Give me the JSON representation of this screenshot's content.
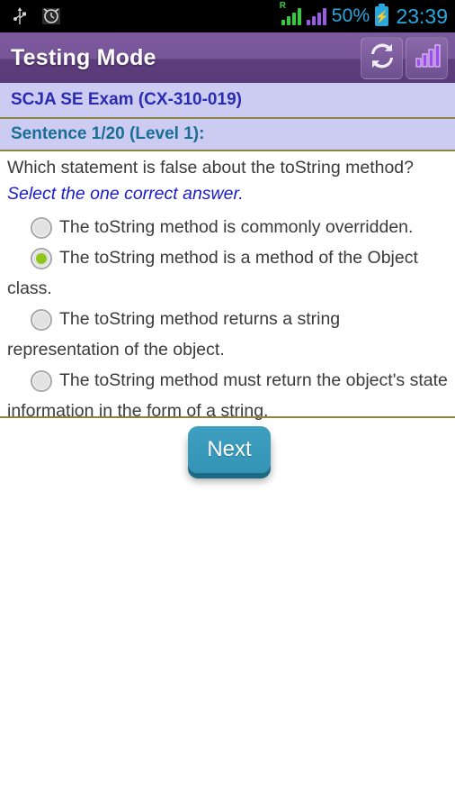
{
  "statusbar": {
    "icons": [
      "usb-icon",
      "alarm-clock-icon"
    ],
    "signal_roaming_label": "R",
    "battery_percent": "50%",
    "battery_state_icon": "battery-charging-icon",
    "time": "23:39",
    "text_color": "#29a8e0",
    "background": "#000000"
  },
  "actionbar": {
    "title": "Testing Mode",
    "background": "#78559a",
    "actions": [
      {
        "name": "refresh-button",
        "icon": "refresh-icon"
      },
      {
        "name": "statistics-button",
        "icon": "bar-chart-icon"
      }
    ]
  },
  "exam": {
    "title": "SCJA SE Exam (CX-310-019)",
    "band_background": "#ccccf2",
    "title_color": "#2b2bb0"
  },
  "sentence": {
    "label": "Sentence 1/20 (Level 1):",
    "label_color": "#1a6e95",
    "current": 1,
    "total": 20,
    "level": 1
  },
  "question": {
    "text": "Which statement is false about the toString method?",
    "hint": "Select the one correct answer.",
    "hint_color": "#1a1ad0"
  },
  "options": [
    {
      "text": "The toString method is commonly overridden.",
      "selected": false
    },
    {
      "text": "The toString method is a method of the Object class.",
      "selected": true
    },
    {
      "text": "The toString method returns a string representation of the object.",
      "selected": false
    },
    {
      "text": "The toString method must return the object's state information in the form of a string.",
      "selected": false
    }
  ],
  "footer": {
    "next_label": "Next",
    "next_color": "#3494b6"
  },
  "divider_color": "#8d8443"
}
